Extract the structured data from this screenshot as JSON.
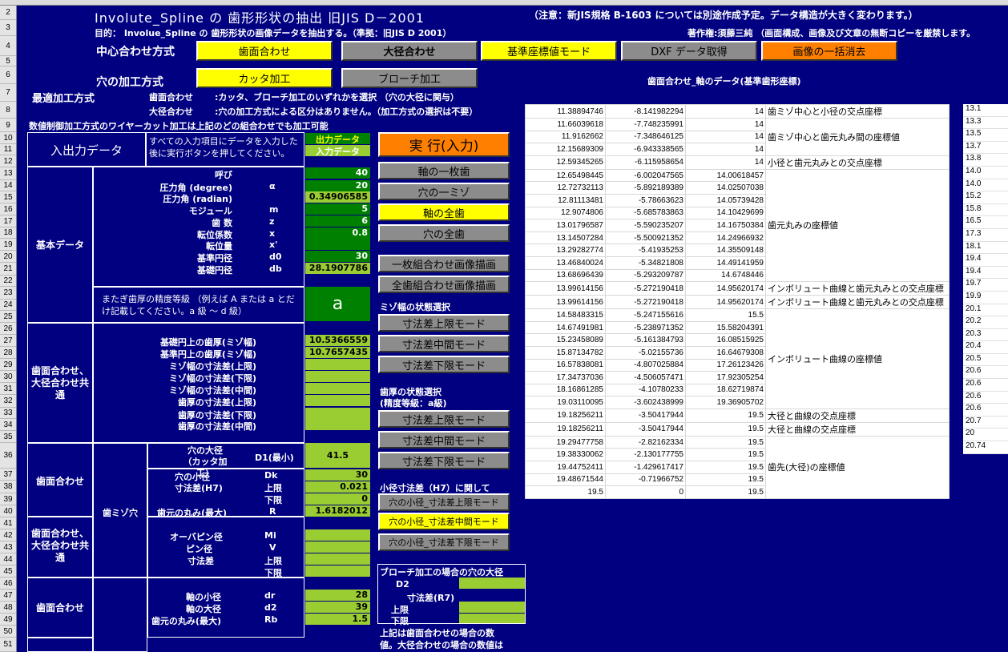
{
  "sheet": {
    "row_numbers": [
      "2",
      "3",
      "4",
      "5",
      "6",
      "7",
      "8",
      "9",
      "10",
      "11",
      "12",
      "13",
      "14",
      "15",
      "16",
      "17",
      "18",
      "19",
      "20",
      "21",
      "22",
      "23",
      "24",
      "25",
      "26",
      "27",
      "28",
      "29",
      "30",
      "31",
      "32",
      "33",
      "34",
      "35",
      "36",
      "37",
      "38",
      "39",
      "40",
      "41",
      "42",
      "43",
      "44",
      "45",
      "46",
      "47",
      "48",
      "49",
      "50",
      "51"
    ]
  },
  "header": {
    "title": "Involute_Spline の 歯形形状の抽出 旧JIS D－2001",
    "notice": "（注意：新JIS規格 B-1603 については別途作成予定。データ構造が大きく変わります。）",
    "purpose": "目的： Involue_Spline の 歯形形状の画像データを抽出する。（準拠：旧JIS D 2001）",
    "copyright": "著作権:須藤三純 （画面構成、画像及び文章の無断コピーを厳禁します。"
  },
  "centering": {
    "label": "中心合わせ方式",
    "btn_flank": "歯面合わせ",
    "btn_major": "大径合わせ",
    "btn_ref": "基準座標値モード",
    "btn_dxf": "DXF データ取得",
    "btn_clear": "画像の一括消去"
  },
  "hole": {
    "label": "穴の加工方式",
    "btn_cutter": "カッタ加工",
    "btn_broach": "ブローチ加工"
  },
  "optimal": {
    "label": "最適加工方式",
    "r1a": "歯面合わせ",
    "r1b": ":カッタ、ブローチ加工のいずれかを選択 （穴の大径に関与）",
    "r2a": "大径合わせ",
    "r2b": ":穴の加工方式による区分はありません。（加工方式の選択は不要）",
    "r3": "数値制御加工方式のワイヤーカット加工は上記のどの組合わせでも加工可能"
  },
  "io": {
    "title": "入出力データ",
    "instruction": "すべての入力項目にデータを入力した後に実行ボタンを押してください。",
    "out_label": "出力データ",
    "in_label": "入力データ"
  },
  "basic": {
    "section": "基本データ",
    "rows": [
      {
        "name": "呼び",
        "sym": "",
        "val": "40"
      },
      {
        "name": "圧力角 (degree)",
        "sym": "α",
        "val": "20"
      },
      {
        "name": "圧力角 (radian)",
        "sym": "",
        "val": "0.34906585"
      },
      {
        "name": "モジュール",
        "sym": "m",
        "val": "5"
      },
      {
        "name": "歯 数",
        "sym": "z",
        "val": "6"
      },
      {
        "name": "転位係数",
        "sym": "x",
        "val": "0.8"
      },
      {
        "name": "転位量",
        "sym": "x'",
        "val": ""
      },
      {
        "name": "基準円径",
        "sym": "d0",
        "val": "30"
      },
      {
        "name": "基礎円径",
        "sym": "db",
        "val": "28.1907786"
      }
    ],
    "grade_note": "またぎ歯厚の精度等級 （例えば A または a とだけ記載してください。a 級 ～ d 級）",
    "grade_val": "a"
  },
  "common": {
    "section": "歯面合わせ、大径合わせ共通",
    "rows": [
      {
        "name": "基礎円上の歯厚(ミゾ幅)",
        "val": "10.5366559"
      },
      {
        "name": "基準円上の歯厚(ミゾ幅)",
        "val": "10.7657435"
      },
      {
        "name": "ミゾ幅の寸法差(上限)",
        "val": ""
      },
      {
        "name": "ミゾ幅の寸法差(下限)",
        "val": ""
      },
      {
        "name": "ミゾ幅の寸法差(中間)",
        "val": ""
      },
      {
        "name": "歯厚の寸法差(上限)",
        "val": ""
      },
      {
        "name": "歯厚の寸法差(下限)",
        "val": ""
      },
      {
        "name": "歯厚の寸法差(中間)",
        "val": ""
      }
    ]
  },
  "slot": {
    "group": "歯ミゾ穴",
    "flank": "歯面合わせ",
    "common": "歯面合わせ、大径合わせ共通",
    "major_dia": "穴の大径 （カッタ加工）",
    "major_sym": "D1(最小)",
    "major_val": "41.5",
    "minor_dia": "穴の小径",
    "minor_sym": "Dk",
    "minor_val": "30",
    "tol": "寸法差(H7)",
    "upper": "上限",
    "upper_val": "0.021",
    "lower": "下限",
    "lower_val": "0",
    "root_r": "歯元の丸み(最大)",
    "root_sym": "R",
    "root_val": "1.6182012",
    "pin_dia": "オーバピン径",
    "pin_sym": "Mi",
    "pin": "ピン径",
    "pin_sym2": "V",
    "pin_tol": "寸法差",
    "pin_up": "上限",
    "pin_low": "下限"
  },
  "shaft": {
    "section": "歯面合わせ",
    "rows": [
      {
        "name": "軸の小径",
        "sym": "dr",
        "val": "28"
      },
      {
        "name": "軸の大径",
        "sym": "d2",
        "val": "39"
      },
      {
        "name": "歯元の丸み(最大)",
        "sym": "Rb",
        "val": "1.5"
      }
    ]
  },
  "actions": {
    "run": "実 行(入力)",
    "b1": "軸の一枚歯",
    "b2": "穴の一ミゾ",
    "b3": "軸の全歯",
    "b4": "穴の全歯",
    "b5": "一枚組合わせ画像描画",
    "b6": "全歯組合わせ画像描画",
    "slot_state": "ミゾ幅の状態選択",
    "s1": "寸法差上限モード",
    "s2": "寸法差中間モード",
    "s3": "寸法差下限モード",
    "thick_state": "歯厚の状態選択",
    "thick_grade": "(精度等級：a級)",
    "t1": "寸法差上限モード",
    "t2": "寸法差中間モード",
    "t3": "寸法差下限モード",
    "minor_state": "小径寸法差（H7）に関して",
    "m1": "穴の小径_寸法差上限モード",
    "m2": "穴の小径_寸法差中間モード",
    "m3": "穴の小径_寸法差下限モード",
    "broach_title": "ブローチ加工の場合の穴の大径",
    "broach_d2": "D2",
    "broach_tol": "寸法差(R7)",
    "broach_up": "上限",
    "broach_low": "下限",
    "footnote1": "上記は歯面合わせの場合の数",
    "footnote2": "値。大径合わせの場合の数値は"
  },
  "data_table": {
    "title": "歯面合わせ_軸のデータ(基準歯形座標)",
    "rows": [
      [
        "11.38894746",
        "-8.141982294",
        "14"
      ],
      [
        "11.66039618",
        "-7.748235991",
        "14"
      ],
      [
        "11.9162662",
        "-7.348646125",
        "14"
      ],
      [
        "12.15689309",
        "-6.943338565",
        "14"
      ],
      [
        "12.59345265",
        "-6.115958654",
        "14"
      ],
      [
        "12.65498445",
        "-6.002047565",
        "14.00618457"
      ],
      [
        "12.72732113",
        "-5.892189389",
        "14.02507038"
      ],
      [
        "12.81113481",
        "-5.78663623",
        "14.05739428"
      ],
      [
        "12.9074806",
        "-5.685783863",
        "14.10429699"
      ],
      [
        "13.01796587",
        "-5.590235207",
        "14.16750384"
      ],
      [
        "13.14507284",
        "-5.500921352",
        "14.24966932"
      ],
      [
        "13.29282774",
        "-5.41935253",
        "14.35509148"
      ],
      [
        "13.46840024",
        "-5.34821808",
        "14.49141959"
      ],
      [
        "13.68696439",
        "-5.293209787",
        "14.6748446"
      ],
      [
        "13.99614156",
        "-5.272190418",
        "14.95620174"
      ],
      [
        "13.99614156",
        "-5.272190418",
        "14.95620174"
      ],
      [
        "14.58483315",
        "-5.247155616",
        "15.5"
      ],
      [
        "14.67491981",
        "-5.238971352",
        "15.58204391"
      ],
      [
        "15.23458089",
        "-5.161384793",
        "16.08515925"
      ],
      [
        "15.87134782",
        "-5.02155736",
        "16.64679308"
      ],
      [
        "16.57838081",
        "-4.807025884",
        "17.26123426"
      ],
      [
        "17.34737036",
        "-4.506057471",
        "17.92305254"
      ],
      [
        "18.16861285",
        "-4.10780233",
        "18.62719874"
      ],
      [
        "19.03110095",
        "-3.602438999",
        "19.36905702"
      ],
      [
        "19.18256211",
        "-3.50417944",
        "19.5"
      ],
      [
        "19.18256211",
        "-3.50417944",
        "19.5"
      ],
      [
        "19.29477758",
        "-2.82162334",
        "19.5"
      ],
      [
        "19.38330062",
        "-2.130177755",
        "19.5"
      ],
      [
        "19.44752411",
        "-1.429617417",
        "19.5"
      ],
      [
        "19.48671544",
        "-0.71966752",
        "19.5"
      ],
      [
        "19.5",
        "0",
        "19.5"
      ]
    ],
    "labels": [
      "歯ミゾ中心と小径の交点座標",
      "歯ミゾ中心と歯元丸み間の座標値",
      "小径と歯元丸みとの交点座標",
      "歯元丸みの座標値",
      "インボリュート曲線と歯元丸みとの交点座標",
      "インボリュート曲線と歯元丸みとの交点座標",
      "インボリュート曲線の座標値",
      "大径と曲線の交点座標",
      "大径と曲線の交点座標",
      "歯先(大径)の座標値"
    ],
    "right_col": [
      "13.1",
      "13.3",
      "13.5",
      "13.7",
      "13.8",
      "14.0",
      "14.0",
      "15.2",
      "15.8",
      "16.5",
      "17.3",
      "18.1",
      "19.4",
      "19.4",
      "19.7",
      "19.9",
      "20.1",
      "20.2",
      "20.3",
      "20.4",
      "20.5",
      "20.6",
      "20.6",
      "20.6",
      "20.6",
      "20.7",
      "20",
      "20.74"
    ]
  }
}
